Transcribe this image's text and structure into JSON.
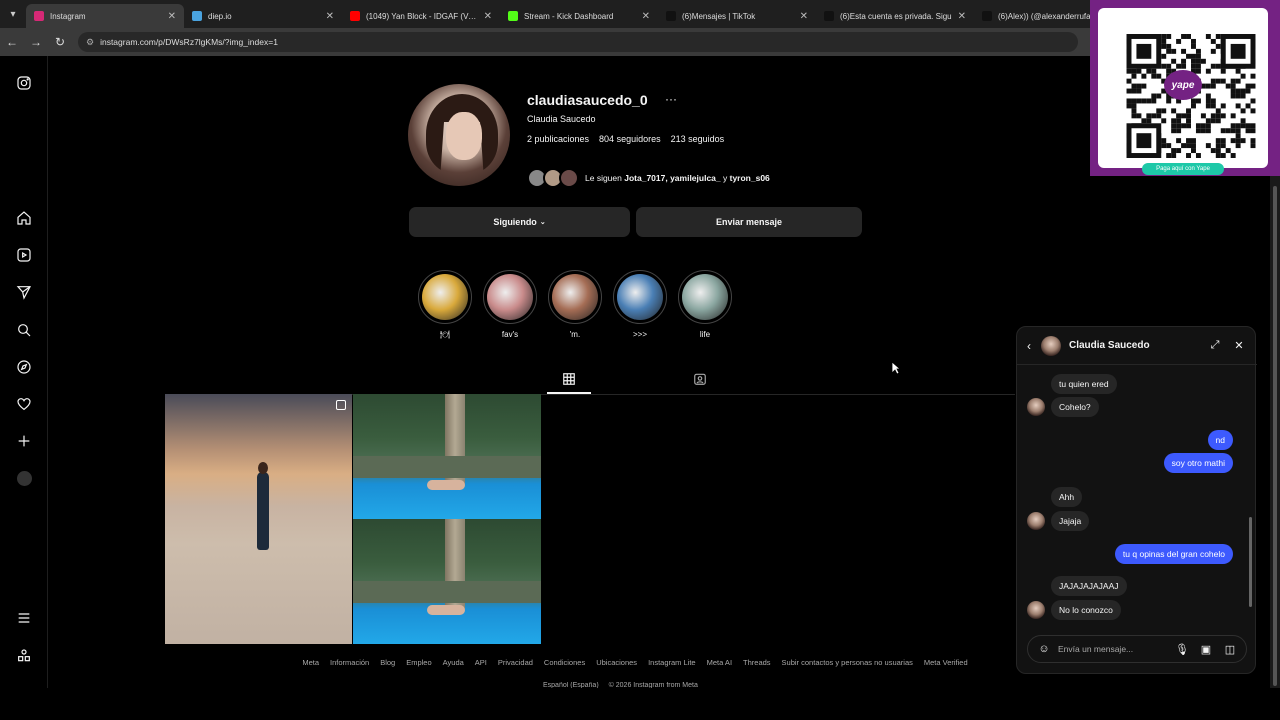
{
  "browser": {
    "tabs": [
      {
        "title": "Instagram",
        "favicon_color": "#d62976",
        "active": true
      },
      {
        "title": "diep.io",
        "favicon_color": "#4aa3df",
        "active": false
      },
      {
        "title": "(1049) Yan Block - IDGAF (Vide",
        "favicon_color": "#ff0000",
        "active": false
      },
      {
        "title": "Stream - Kick Dashboard",
        "favicon_color": "#53fc18",
        "active": false
      },
      {
        "title": "(6)Mensajes | TikTok",
        "favicon_color": "#111111",
        "active": false
      },
      {
        "title": "(6)Esta cuenta es privada. Sigu",
        "favicon_color": "#111111",
        "active": false
      },
      {
        "title": "(6)Alex)) (@alexanderrufa",
        "favicon_color": "#111111",
        "active": false
      }
    ],
    "url": "instagram.com/p/DWsRz7lgKMs/?img_index=1"
  },
  "profile": {
    "username": "claudiasaucedo_0",
    "more_label": "···",
    "full_name": "Claudia Saucedo",
    "stats": {
      "posts": "2 publicaciones",
      "followers": "804 seguidores",
      "following": "213 seguidos"
    },
    "followed_by": {
      "prefix": "Le siguen ",
      "names": "Jota_7017, yamilejulca_",
      "joiner": " y ",
      "last": "tyron_s06"
    },
    "buttons": {
      "following": "Siguiendo",
      "message": "Enviar mensaje"
    }
  },
  "highlights": [
    {
      "label": "🍽",
      "color": "#d9a93b"
    },
    {
      "label": "fav's",
      "color": "#c98b8b"
    },
    {
      "label": "'m.",
      "color": "#a56d55"
    },
    {
      "label": ">>>",
      "color": "#4a7fb5"
    },
    {
      "label": "life",
      "color": "#8aa6a0"
    }
  ],
  "footer": {
    "links": [
      "Meta",
      "Información",
      "Blog",
      "Empleo",
      "Ayuda",
      "API",
      "Privacidad",
      "Condiciones",
      "Ubicaciones",
      "Instagram Lite",
      "Meta AI",
      "Threads",
      "Subir contactos y personas no usuarias",
      "Meta Verified"
    ],
    "language": "Español (España)",
    "copyright": "© 2026 Instagram from Meta"
  },
  "yape": {
    "button_label": "Paga aquí con Yape",
    "brand_color": "#742283",
    "qr_label": "yape"
  },
  "chat": {
    "contact": "Claudia Saucedo",
    "messages": [
      {
        "dir": "in",
        "text": "tu quien ered"
      },
      {
        "dir": "in",
        "text": "Cohelo?"
      },
      {
        "dir": "out",
        "text": "nd"
      },
      {
        "dir": "out",
        "text": "soy otro mathi"
      },
      {
        "dir": "in",
        "text": "Ahh"
      },
      {
        "dir": "in",
        "text": "Jajaja"
      },
      {
        "dir": "out",
        "text": "tu q opinas del gran cohelo"
      },
      {
        "dir": "in",
        "text": "JAJAJAJAJAAJ"
      },
      {
        "dir": "in",
        "text": "No lo conozco"
      }
    ],
    "input_placeholder": "Envía un mensaje...",
    "outgoing_color": "#3d5afe"
  }
}
